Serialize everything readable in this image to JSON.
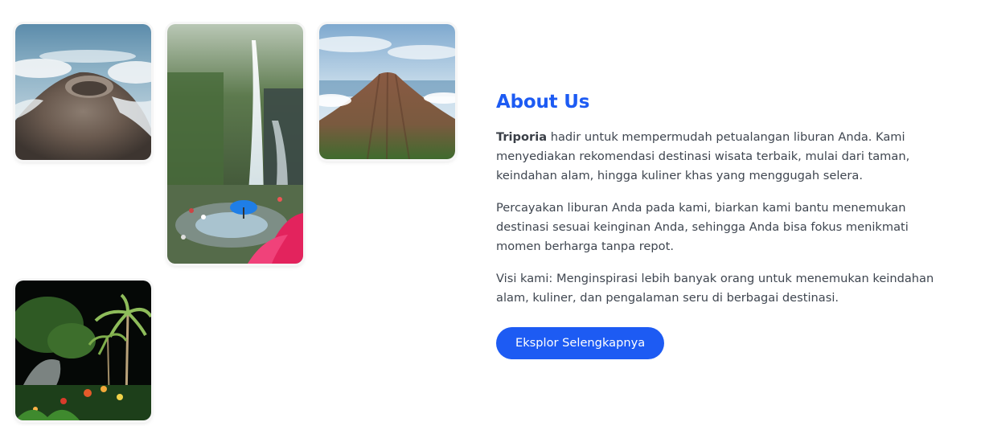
{
  "gallery": {
    "images": [
      {
        "subject": "aerial view of volcano crater above clouds"
      },
      {
        "subject": "waterfall park with visitors and blue umbrella"
      },
      {
        "subject": "green volcano peak above sea of clouds"
      },
      {
        "subject": "tropical garden with palm trees at night"
      }
    ]
  },
  "about": {
    "title": "About Us",
    "brand": "Triporia",
    "intro_rest": " hadir untuk mempermudah petualangan liburan Anda. Kami menyediakan rekomendasi destinasi wisata terbaik, mulai dari taman, keindahan alam, hingga kuliner khas yang menggugah selera.",
    "paragraph_2": "Percayakan liburan Anda pada kami, biarkan kami bantu menemukan destinasi sesuai keinginan Anda, sehingga Anda bisa fokus menikmati momen berharga tanpa repot.",
    "paragraph_3": "Visi kami: Menginspirasi lebih banyak orang untuk menemukan keindahan alam, kuliner, dan pengalaman seru di berbagai destinasi.",
    "cta_label": "Eksplor Selengkapnya"
  },
  "colors": {
    "accent": "#1d5bf3",
    "body_text": "#3f4650",
    "background": "#ffffff"
  }
}
